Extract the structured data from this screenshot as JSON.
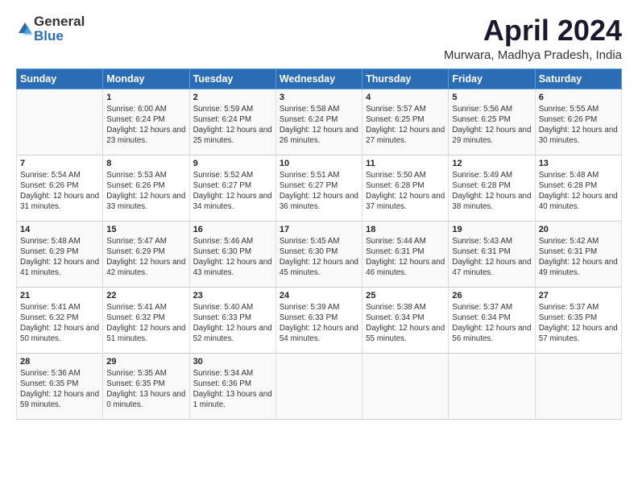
{
  "header": {
    "logo_general": "General",
    "logo_blue": "Blue",
    "title": "April 2024",
    "location": "Murwara, Madhya Pradesh, India"
  },
  "weekdays": [
    "Sunday",
    "Monday",
    "Tuesday",
    "Wednesday",
    "Thursday",
    "Friday",
    "Saturday"
  ],
  "weeks": [
    [
      {
        "day": "",
        "sunrise": "",
        "sunset": "",
        "daylight": ""
      },
      {
        "day": "1",
        "sunrise": "Sunrise: 6:00 AM",
        "sunset": "Sunset: 6:24 PM",
        "daylight": "Daylight: 12 hours and 23 minutes."
      },
      {
        "day": "2",
        "sunrise": "Sunrise: 5:59 AM",
        "sunset": "Sunset: 6:24 PM",
        "daylight": "Daylight: 12 hours and 25 minutes."
      },
      {
        "day": "3",
        "sunrise": "Sunrise: 5:58 AM",
        "sunset": "Sunset: 6:24 PM",
        "daylight": "Daylight: 12 hours and 26 minutes."
      },
      {
        "day": "4",
        "sunrise": "Sunrise: 5:57 AM",
        "sunset": "Sunset: 6:25 PM",
        "daylight": "Daylight: 12 hours and 27 minutes."
      },
      {
        "day": "5",
        "sunrise": "Sunrise: 5:56 AM",
        "sunset": "Sunset: 6:25 PM",
        "daylight": "Daylight: 12 hours and 29 minutes."
      },
      {
        "day": "6",
        "sunrise": "Sunrise: 5:55 AM",
        "sunset": "Sunset: 6:26 PM",
        "daylight": "Daylight: 12 hours and 30 minutes."
      }
    ],
    [
      {
        "day": "7",
        "sunrise": "Sunrise: 5:54 AM",
        "sunset": "Sunset: 6:26 PM",
        "daylight": "Daylight: 12 hours and 31 minutes."
      },
      {
        "day": "8",
        "sunrise": "Sunrise: 5:53 AM",
        "sunset": "Sunset: 6:26 PM",
        "daylight": "Daylight: 12 hours and 33 minutes."
      },
      {
        "day": "9",
        "sunrise": "Sunrise: 5:52 AM",
        "sunset": "Sunset: 6:27 PM",
        "daylight": "Daylight: 12 hours and 34 minutes."
      },
      {
        "day": "10",
        "sunrise": "Sunrise: 5:51 AM",
        "sunset": "Sunset: 6:27 PM",
        "daylight": "Daylight: 12 hours and 36 minutes."
      },
      {
        "day": "11",
        "sunrise": "Sunrise: 5:50 AM",
        "sunset": "Sunset: 6:28 PM",
        "daylight": "Daylight: 12 hours and 37 minutes."
      },
      {
        "day": "12",
        "sunrise": "Sunrise: 5:49 AM",
        "sunset": "Sunset: 6:28 PM",
        "daylight": "Daylight: 12 hours and 38 minutes."
      },
      {
        "day": "13",
        "sunrise": "Sunrise: 5:48 AM",
        "sunset": "Sunset: 6:28 PM",
        "daylight": "Daylight: 12 hours and 40 minutes."
      }
    ],
    [
      {
        "day": "14",
        "sunrise": "Sunrise: 5:48 AM",
        "sunset": "Sunset: 6:29 PM",
        "daylight": "Daylight: 12 hours and 41 minutes."
      },
      {
        "day": "15",
        "sunrise": "Sunrise: 5:47 AM",
        "sunset": "Sunset: 6:29 PM",
        "daylight": "Daylight: 12 hours and 42 minutes."
      },
      {
        "day": "16",
        "sunrise": "Sunrise: 5:46 AM",
        "sunset": "Sunset: 6:30 PM",
        "daylight": "Daylight: 12 hours and 43 minutes."
      },
      {
        "day": "17",
        "sunrise": "Sunrise: 5:45 AM",
        "sunset": "Sunset: 6:30 PM",
        "daylight": "Daylight: 12 hours and 45 minutes."
      },
      {
        "day": "18",
        "sunrise": "Sunrise: 5:44 AM",
        "sunset": "Sunset: 6:31 PM",
        "daylight": "Daylight: 12 hours and 46 minutes."
      },
      {
        "day": "19",
        "sunrise": "Sunrise: 5:43 AM",
        "sunset": "Sunset: 6:31 PM",
        "daylight": "Daylight: 12 hours and 47 minutes."
      },
      {
        "day": "20",
        "sunrise": "Sunrise: 5:42 AM",
        "sunset": "Sunset: 6:31 PM",
        "daylight": "Daylight: 12 hours and 49 minutes."
      }
    ],
    [
      {
        "day": "21",
        "sunrise": "Sunrise: 5:41 AM",
        "sunset": "Sunset: 6:32 PM",
        "daylight": "Daylight: 12 hours and 50 minutes."
      },
      {
        "day": "22",
        "sunrise": "Sunrise: 5:41 AM",
        "sunset": "Sunset: 6:32 PM",
        "daylight": "Daylight: 12 hours and 51 minutes."
      },
      {
        "day": "23",
        "sunrise": "Sunrise: 5:40 AM",
        "sunset": "Sunset: 6:33 PM",
        "daylight": "Daylight: 12 hours and 52 minutes."
      },
      {
        "day": "24",
        "sunrise": "Sunrise: 5:39 AM",
        "sunset": "Sunset: 6:33 PM",
        "daylight": "Daylight: 12 hours and 54 minutes."
      },
      {
        "day": "25",
        "sunrise": "Sunrise: 5:38 AM",
        "sunset": "Sunset: 6:34 PM",
        "daylight": "Daylight: 12 hours and 55 minutes."
      },
      {
        "day": "26",
        "sunrise": "Sunrise: 5:37 AM",
        "sunset": "Sunset: 6:34 PM",
        "daylight": "Daylight: 12 hours and 56 minutes."
      },
      {
        "day": "27",
        "sunrise": "Sunrise: 5:37 AM",
        "sunset": "Sunset: 6:35 PM",
        "daylight": "Daylight: 12 hours and 57 minutes."
      }
    ],
    [
      {
        "day": "28",
        "sunrise": "Sunrise: 5:36 AM",
        "sunset": "Sunset: 6:35 PM",
        "daylight": "Daylight: 12 hours and 59 minutes."
      },
      {
        "day": "29",
        "sunrise": "Sunrise: 5:35 AM",
        "sunset": "Sunset: 6:35 PM",
        "daylight": "Daylight: 13 hours and 0 minutes."
      },
      {
        "day": "30",
        "sunrise": "Sunrise: 5:34 AM",
        "sunset": "Sunset: 6:36 PM",
        "daylight": "Daylight: 13 hours and 1 minute."
      },
      {
        "day": "",
        "sunrise": "",
        "sunset": "",
        "daylight": ""
      },
      {
        "day": "",
        "sunrise": "",
        "sunset": "",
        "daylight": ""
      },
      {
        "day": "",
        "sunrise": "",
        "sunset": "",
        "daylight": ""
      },
      {
        "day": "",
        "sunrise": "",
        "sunset": "",
        "daylight": ""
      }
    ]
  ]
}
